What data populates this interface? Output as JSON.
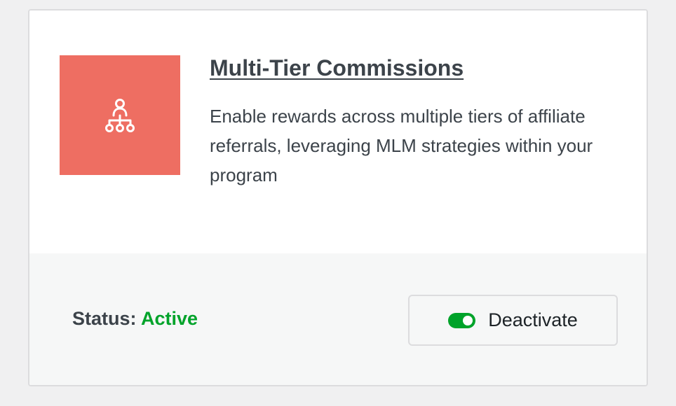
{
  "addon": {
    "icon": "hierarchy-icon",
    "title": "Multi-Tier Commissions",
    "description": "Enable rewards across multiple tiers of affiliate referrals, leveraging MLM strategies within your program"
  },
  "footer": {
    "status_label": "Status:",
    "status_value": "Active",
    "button_label": "Deactivate",
    "toggle_state": "on"
  },
  "colors": {
    "thumb_bg": "#ee6e62",
    "active_green": "#00a32a",
    "text": "#3c434a"
  }
}
